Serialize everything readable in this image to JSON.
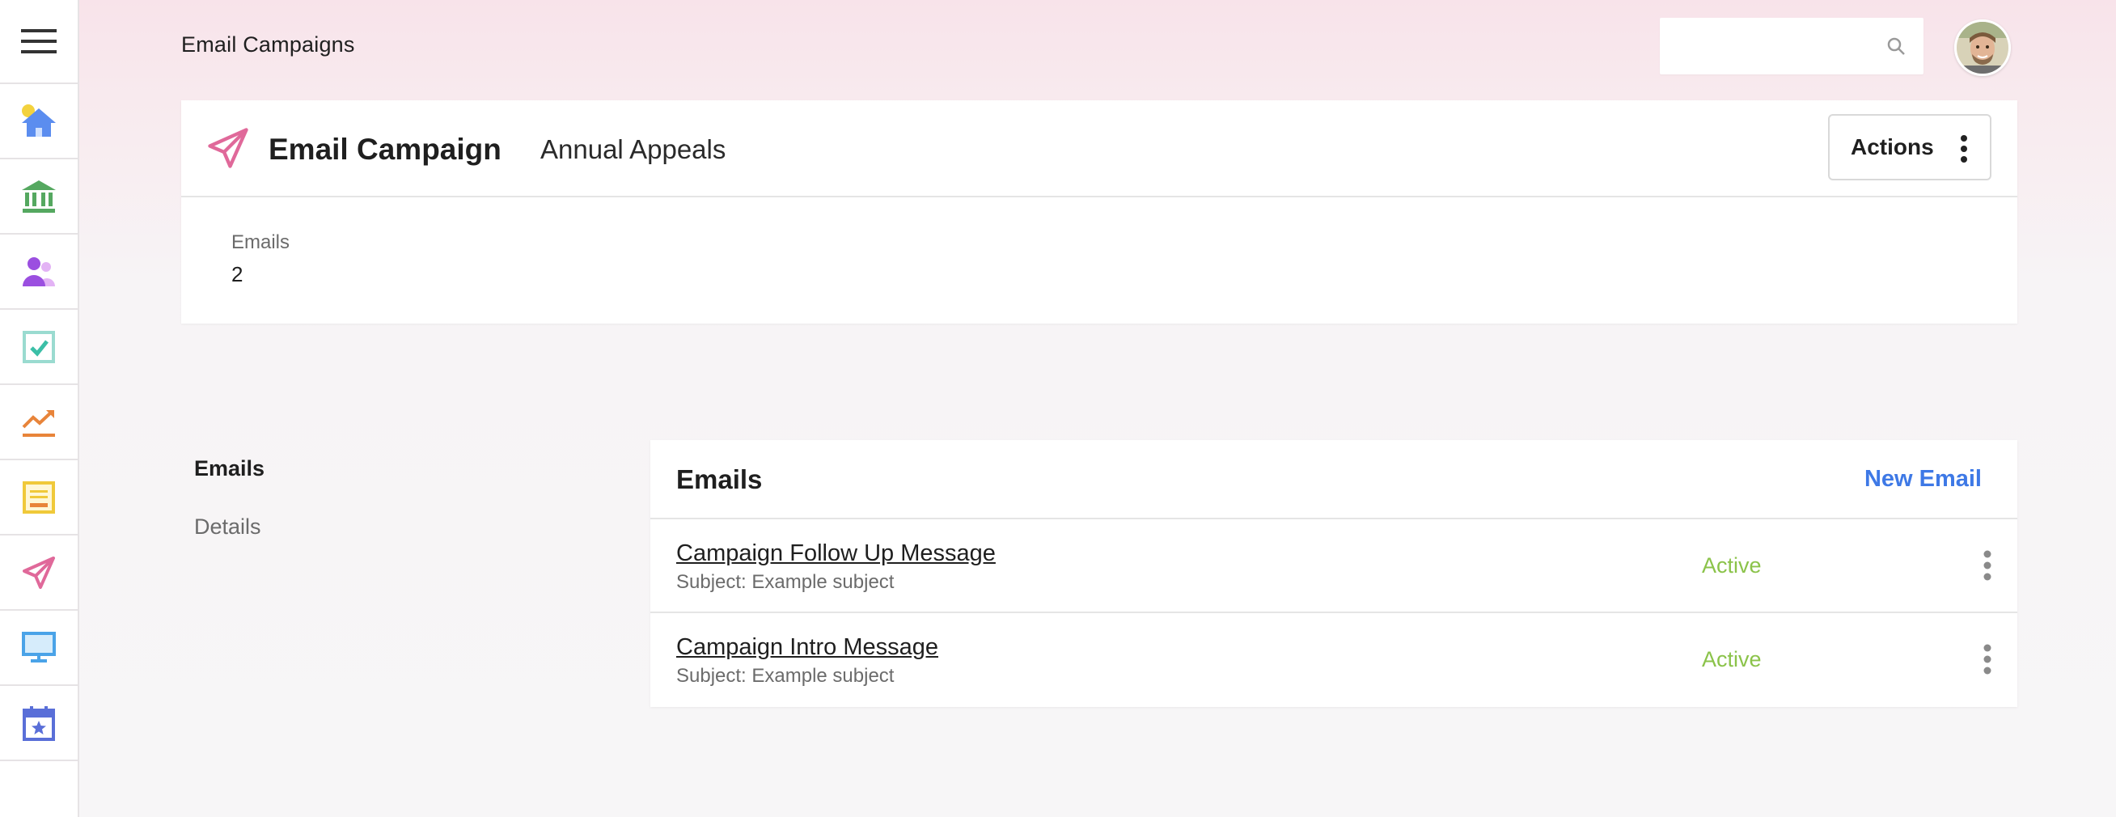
{
  "topbar": {
    "title": "Email Campaigns",
    "search_placeholder": "",
    "search_icon": "search-icon"
  },
  "sidebar": {
    "menu_icon": "hamburger-icon",
    "items": [
      {
        "icon": "home-icon",
        "color": "#5b8def"
      },
      {
        "icon": "bank-icon",
        "color": "#55a860"
      },
      {
        "icon": "people-icon",
        "color": "#9b4fe0"
      },
      {
        "icon": "checkbox-icon",
        "color": "#3bbfa7"
      },
      {
        "icon": "trend-icon",
        "color": "#e8843a"
      },
      {
        "icon": "document-icon",
        "color": "#f0c93a"
      },
      {
        "icon": "paper-plane-icon",
        "color": "#e0699a"
      },
      {
        "icon": "monitor-icon",
        "color": "#4aa3e8"
      },
      {
        "icon": "calendar-icon",
        "color": "#5a6fd8"
      }
    ]
  },
  "header": {
    "title": "Email Campaign",
    "subtitle": "Annual Appeals",
    "actions_label": "Actions",
    "stat_label": "Emails",
    "stat_value": "2",
    "accent": "#e0699a"
  },
  "subnav": {
    "items": [
      {
        "label": "Emails",
        "active": true
      },
      {
        "label": "Details",
        "active": false
      }
    ]
  },
  "emails": {
    "title": "Emails",
    "new_label": "New Email",
    "rows": [
      {
        "name": "Campaign Follow Up Message",
        "subject": "Subject: Example subject",
        "status": "Active"
      },
      {
        "name": "Campaign Intro Message",
        "subject": "Subject: Example subject",
        "status": "Active"
      }
    ],
    "status_color": "#8bc34a",
    "link_color": "#3e79e6"
  }
}
